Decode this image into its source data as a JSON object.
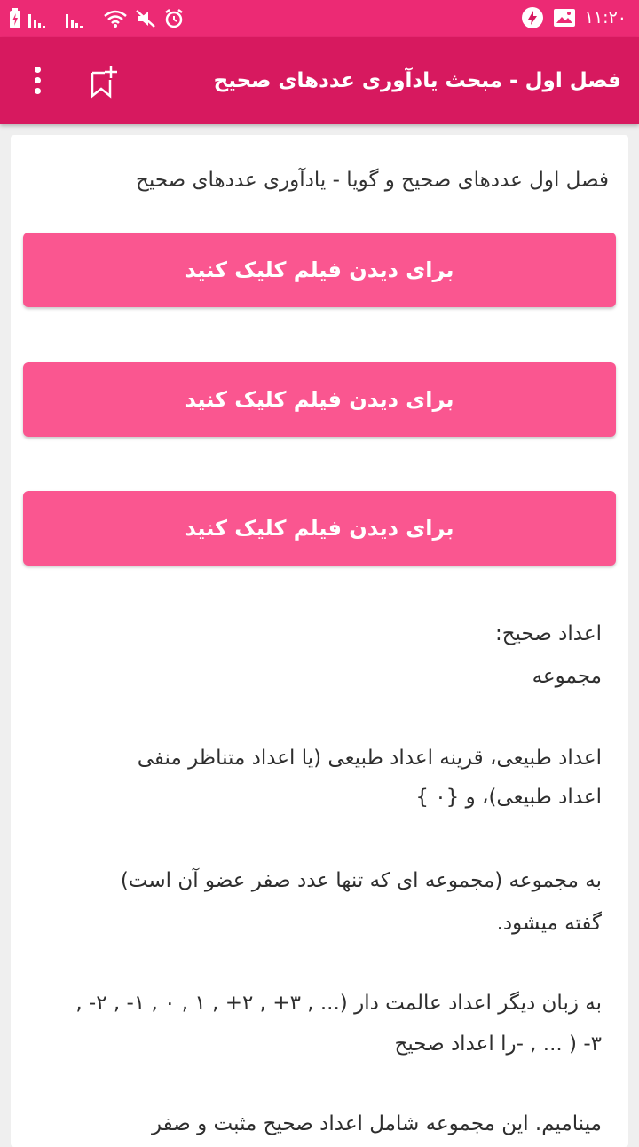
{
  "status_bar": {
    "time": "۱۱:۲۰"
  },
  "app_bar": {
    "title": "فصل اول - مبحث یادآوری عددهای صحیح"
  },
  "content": {
    "heading": "فصل اول عددهای صحیح و گویا - یادآوری عددهای صحیح",
    "video_buttons": [
      {
        "label": "برای دیدن فیلم کلیک کنید"
      },
      {
        "label": "برای دیدن فیلم کلیک کنید"
      },
      {
        "label": "برای دیدن فیلم کلیک کنید"
      }
    ],
    "lines": [
      "اعداد صحیح:",
      "مجموعه",
      "اعداد طبیعی، قرینه اعداد طبیعی (یا اعداد متناظر منفی",
      "اعداد طبیعی)، و {۰ }",
      "به مجموعه (مجموعه ای که تنها عدد صفر عضو آن است)",
      "گفته میشود.",
      "به زبان دیگر اعداد عالمت دار (... , ۳+ , ۲+ , ۱ , ۰ , ۱- , ۲- ,",
      "۳- ( ... , -را اعداد صحیح",
      "مینامیم. این مجموعه شامل اعداد صحیح مثبت و صفر"
    ]
  }
}
